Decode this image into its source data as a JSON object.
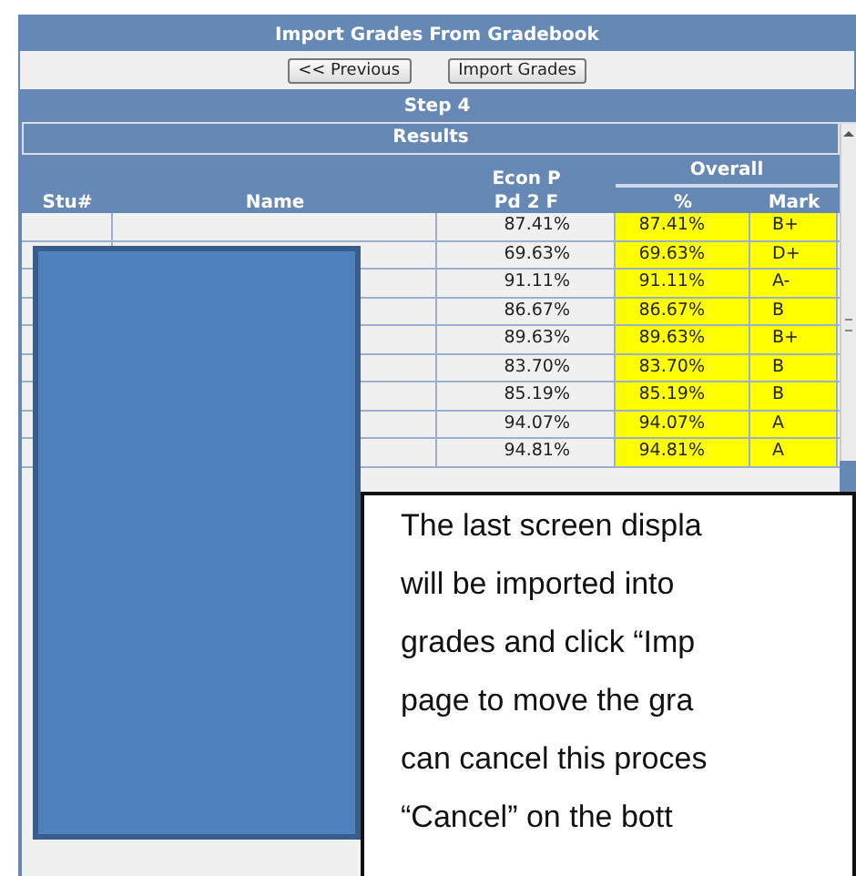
{
  "title": "Import Grades From Gradebook",
  "buttons": [
    "<< Previous",
    "Import Grades"
  ],
  "step": "Step 4",
  "results": {
    "title": "Results",
    "columns": [
      {
        "label": "Stu#"
      },
      {
        "label": "Name"
      },
      {
        "label": "Econ P\nPd 2 F"
      }
    ],
    "group": {
      "label": "Overall",
      "columns": [
        "%",
        "Mark"
      ]
    },
    "rows": [
      {
        "econ": "87.41%",
        "pct": "87.41%",
        "mark": "B+"
      },
      {
        "econ": "69.63%",
        "pct": "69.63%",
        "mark": "D+"
      },
      {
        "econ": "91.11%",
        "pct": "91.11%",
        "mark": "A-"
      },
      {
        "econ": "86.67%",
        "pct": "86.67%",
        "mark": "B"
      },
      {
        "econ": "89.63%",
        "pct": "89.63%",
        "mark": "B+"
      },
      {
        "econ": "83.70%",
        "pct": "83.70%",
        "mark": "B"
      },
      {
        "econ": "85.19%",
        "pct": "85.19%",
        "mark": "B"
      },
      {
        "econ": "94.07%",
        "pct": "94.07%",
        "mark": "A"
      },
      {
        "econ": "94.81%",
        "pct": "94.81%",
        "mark": "A"
      }
    ]
  },
  "callout": {
    "lines": [
      "The last screen displa",
      "will be imported into",
      "grades and click “Imp",
      "page to move the gra",
      "can cancel this proces",
      "“Cancel” on the bott"
    ]
  }
}
